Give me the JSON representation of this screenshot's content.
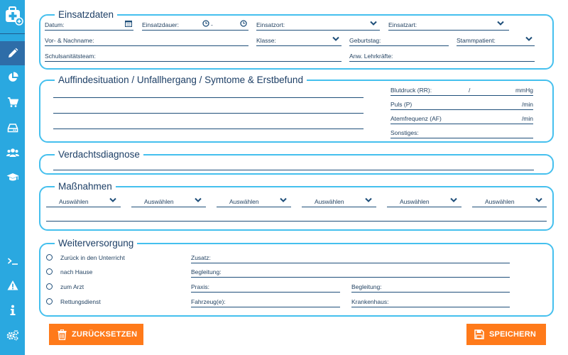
{
  "sidebar": {
    "logo_icon": "first-aid-kit-icon",
    "items": [
      {
        "icon": "pencil-icon",
        "active": true
      },
      {
        "icon": "pie-chart-icon"
      },
      {
        "icon": "cart-icon"
      },
      {
        "icon": "hard-drive-icon"
      },
      {
        "icon": "users-icon"
      },
      {
        "icon": "graduation-cap-icon"
      }
    ],
    "bottom_items": [
      {
        "icon": "terminal-icon"
      },
      {
        "icon": "warning-icon"
      },
      {
        "icon": "info-icon"
      },
      {
        "icon": "gears-icon"
      }
    ]
  },
  "einsatzdaten": {
    "title": "Einsatzdaten",
    "datum_label": "Datum:",
    "einsatzdauer_label": "Einsatzdauer:",
    "dauer_separator": "-",
    "einsatzort_label": "Einsatzort:",
    "einsatzart_label": "Einsatzart:",
    "name_label": "Vor- & Nachname:",
    "klasse_label": "Klasse:",
    "geburtstag_label": "Geburtstag:",
    "stammpatient_label": "Stammpatient:",
    "team_label": "Schulsanitätsteam:",
    "lehrkraefte_label": "Anw. Lehrkräfte:"
  },
  "auffindesituation": {
    "title": "Auffindesituation / Unfallhergang / Symtome & Erstbefund",
    "blutdruck_label": "Blutdruck (RR):",
    "blutdruck_sep": "/",
    "blutdruck_unit": "mmHg",
    "puls_label": "Puls (P)",
    "puls_unit": "/min",
    "atem_label": "Atemfrequenz (AF)",
    "atem_unit": "/min",
    "sonstiges_label": "Sonstiges:"
  },
  "verdachtsdiagnose": {
    "title": "Verdachtsdiagnose"
  },
  "massnahmen": {
    "title": "Maßnahmen",
    "selects": [
      "Auswählen",
      "Auswählen",
      "Auswählen",
      "Auswählen",
      "Auswählen",
      "Auswählen"
    ]
  },
  "weiterversorgung": {
    "title": "Weiterversorgung",
    "options": [
      "Zurück in den Unterricht",
      "nach Hause",
      "zum Arzt",
      "Rettungsdienst"
    ],
    "zusatz_label": "Zusatz:",
    "begleitung_label": "Begleitung:",
    "praxis_label": "Praxis:",
    "begleitung2_label": "Begleitung:",
    "fahrzeug_label": "Fahrzeug(e):",
    "krankenhaus_label": "Krankenhaus:"
  },
  "buttons": {
    "reset_label": "ZURÜCKSETZEN",
    "save_label": "SPEICHERN"
  },
  "colors": {
    "sidebar": "#2aa8e0",
    "sidebar_active": "#2e6da8",
    "fieldset_border": "#45c0ee",
    "button": "#ff7a1a"
  }
}
